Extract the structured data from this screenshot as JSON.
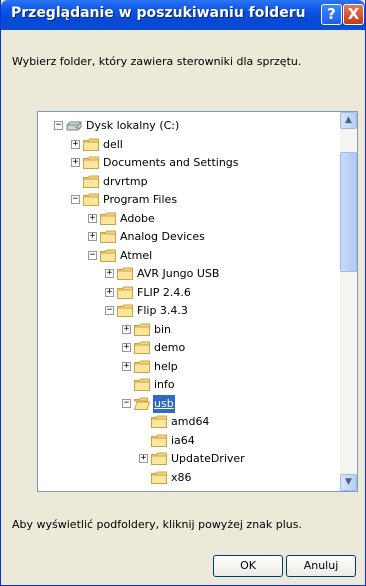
{
  "window": {
    "title": "Przeglądanie w poszukiwaniu folderu",
    "help_label": "?",
    "close_label": "X",
    "description": "Wybierz folder, który zawiera sterowniki dla sprzętu.",
    "hint": "Aby wyświetlić podfoldery, kliknij powyżej znak plus."
  },
  "tree": {
    "items": [
      {
        "label": "Dysk lokalny (C:)",
        "level": 0,
        "expander": "−",
        "icon": "drive-icon"
      },
      {
        "label": "dell",
        "level": 1,
        "expander": "+",
        "icon": "folder-icon"
      },
      {
        "label": "Documents and Settings",
        "level": 1,
        "expander": "+",
        "icon": "folder-icon"
      },
      {
        "label": "drvrtmp",
        "level": 1,
        "expander": "",
        "icon": "folder-icon"
      },
      {
        "label": "Program Files",
        "level": 1,
        "expander": "−",
        "icon": "folder-icon"
      },
      {
        "label": "Adobe",
        "level": 2,
        "expander": "+",
        "icon": "folder-icon"
      },
      {
        "label": "Analog Devices",
        "level": 2,
        "expander": "+",
        "icon": "folder-icon"
      },
      {
        "label": "Atmel",
        "level": 2,
        "expander": "−",
        "icon": "folder-icon"
      },
      {
        "label": "AVR Jungo USB",
        "level": 3,
        "expander": "+",
        "icon": "folder-icon"
      },
      {
        "label": "FLIP 2.4.6",
        "level": 3,
        "expander": "+",
        "icon": "folder-icon"
      },
      {
        "label": "Flip 3.4.3",
        "level": 3,
        "expander": "−",
        "icon": "folder-icon"
      },
      {
        "label": "bin",
        "level": 4,
        "expander": "+",
        "icon": "folder-icon"
      },
      {
        "label": "demo",
        "level": 4,
        "expander": "+",
        "icon": "folder-icon"
      },
      {
        "label": "help",
        "level": 4,
        "expander": "+",
        "icon": "folder-icon"
      },
      {
        "label": "info",
        "level": 4,
        "expander": "",
        "icon": "folder-icon"
      },
      {
        "label": "usb",
        "level": 4,
        "expander": "−",
        "icon": "open-folder-icon",
        "selected": true
      },
      {
        "label": "amd64",
        "level": 5,
        "expander": "",
        "icon": "folder-icon"
      },
      {
        "label": "ia64",
        "level": 5,
        "expander": "",
        "icon": "folder-icon"
      },
      {
        "label": "UpdateDriver",
        "level": 5,
        "expander": "+",
        "icon": "folder-icon"
      },
      {
        "label": "x86",
        "level": 5,
        "expander": "",
        "icon": "folder-icon"
      }
    ]
  },
  "buttons": {
    "ok": "OK",
    "cancel": "Anuluj"
  },
  "colors": {
    "titlebar": "#0c55e5",
    "selection": "#316ac5",
    "dialog_bg": "#ece9d8"
  }
}
